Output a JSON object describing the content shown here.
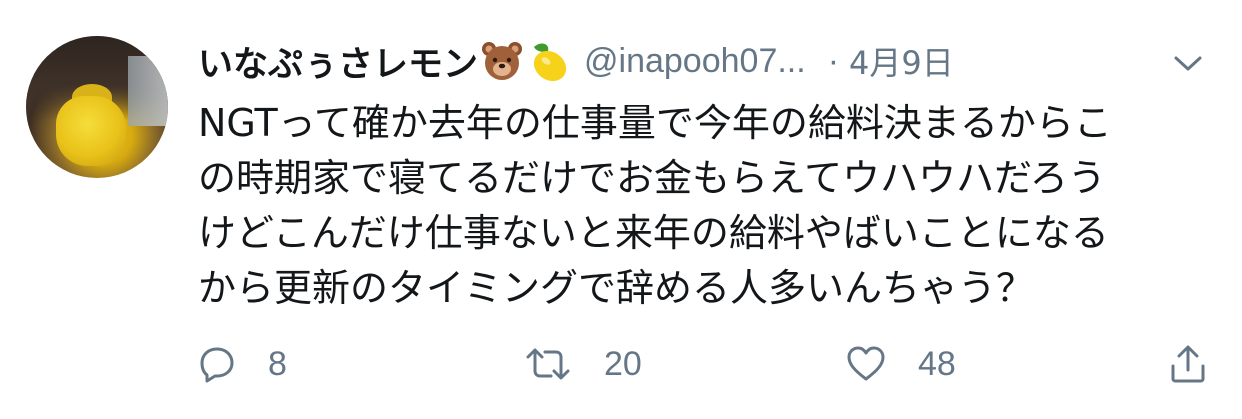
{
  "tweet": {
    "display_name": "いなぷぅさレモン",
    "emojis": [
      "bear-face-emoji",
      "lemon-emoji"
    ],
    "handle": "@inapooh07...",
    "separator": "·",
    "date": "4月9日",
    "text_lines": [
      "NGTって確か去年の仕事量で今年の給料決まるからこ",
      "の時期家で寝てるだけでお金もらえてウハウハだろう",
      "けどこんだけ仕事ないと来年の給料やばいことになる",
      "から更新のタイミングで辞める人多いんちゃう？"
    ],
    "actions": {
      "reply_count": "8",
      "retweet_count": "20",
      "like_count": "48"
    }
  },
  "colors": {
    "text": "#14171a",
    "secondary": "#657786",
    "background": "#ffffff"
  },
  "icons": {
    "reply": "reply-icon",
    "retweet": "retweet-icon",
    "like": "heart-icon",
    "share": "share-icon",
    "menu": "chevron-down-icon"
  }
}
